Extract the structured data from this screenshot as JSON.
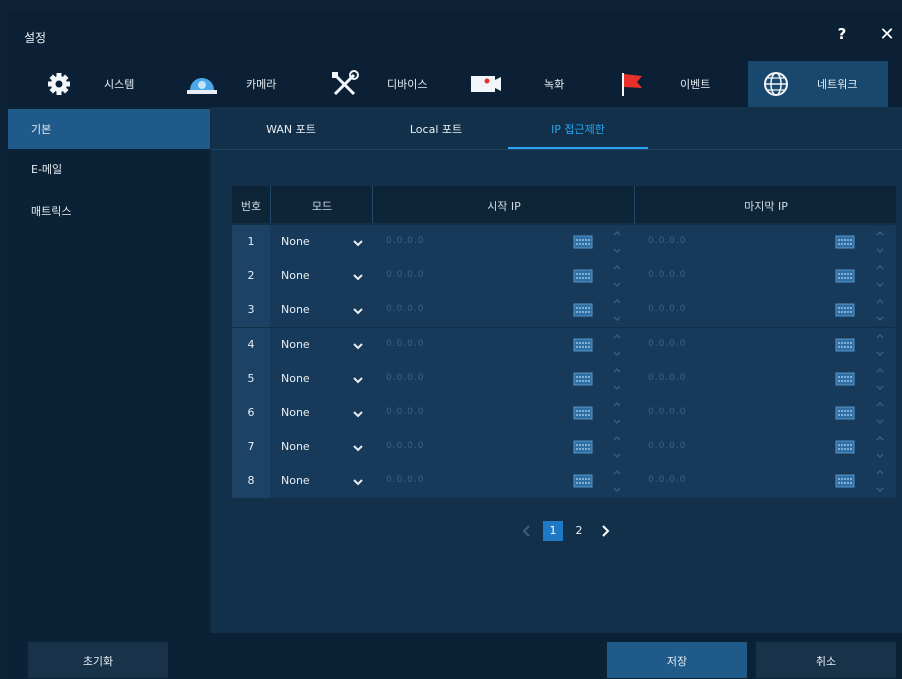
{
  "window": {
    "title": "설정",
    "help_label": "?",
    "close_label": "✕"
  },
  "tabs": [
    {
      "label": "시스템",
      "icon": "gear-icon"
    },
    {
      "label": "카메라",
      "icon": "camera-dome-icon"
    },
    {
      "label": "디바이스",
      "icon": "tools-icon"
    },
    {
      "label": "녹화",
      "icon": "record-icon"
    },
    {
      "label": "이벤트",
      "icon": "flag-icon"
    },
    {
      "label": "네트워크",
      "icon": "globe-icon",
      "active": true
    }
  ],
  "sidebar": {
    "items": [
      {
        "label": "기본",
        "active": true
      },
      {
        "label": "E-메일"
      },
      {
        "label": "매트릭스"
      }
    ]
  },
  "subtabs": [
    {
      "label": "WAN 포트"
    },
    {
      "label": "Local 포트"
    },
    {
      "label": "IP 접근제한",
      "active": true
    }
  ],
  "table": {
    "headers": {
      "no": "번호",
      "mode": "모드",
      "start_ip": "시작 IP",
      "end_ip": "마지막 IP"
    },
    "rows": [
      {
        "no": "1",
        "mode": "None",
        "start_ip": "0.0.0.0",
        "end_ip": "0.0.0.0"
      },
      {
        "no": "2",
        "mode": "None",
        "start_ip": "0.0.0.0",
        "end_ip": "0.0.0.0"
      },
      {
        "no": "3",
        "mode": "None",
        "start_ip": "0.0.0.0",
        "end_ip": "0.0.0.0"
      },
      {
        "no": "4",
        "mode": "None",
        "start_ip": "0.0.0.0",
        "end_ip": "0.0.0.0"
      },
      {
        "no": "5",
        "mode": "None",
        "start_ip": "0.0.0.0",
        "end_ip": "0.0.0.0"
      },
      {
        "no": "6",
        "mode": "None",
        "start_ip": "0.0.0.0",
        "end_ip": "0.0.0.0"
      },
      {
        "no": "7",
        "mode": "None",
        "start_ip": "0.0.0.0",
        "end_ip": "0.0.0.0"
      },
      {
        "no": "8",
        "mode": "None",
        "start_ip": "0.0.0.0",
        "end_ip": "0.0.0.0"
      }
    ]
  },
  "pager": {
    "pages": [
      "1",
      "2"
    ],
    "current": "1"
  },
  "footer": {
    "reset_label": "초기화",
    "save_label": "저장",
    "cancel_label": "취소"
  },
  "colors": {
    "accent": "#2aa5f5",
    "active_bg": "#1f5a8a",
    "flag": "#e8302a",
    "camera": "#4aa8e8"
  }
}
